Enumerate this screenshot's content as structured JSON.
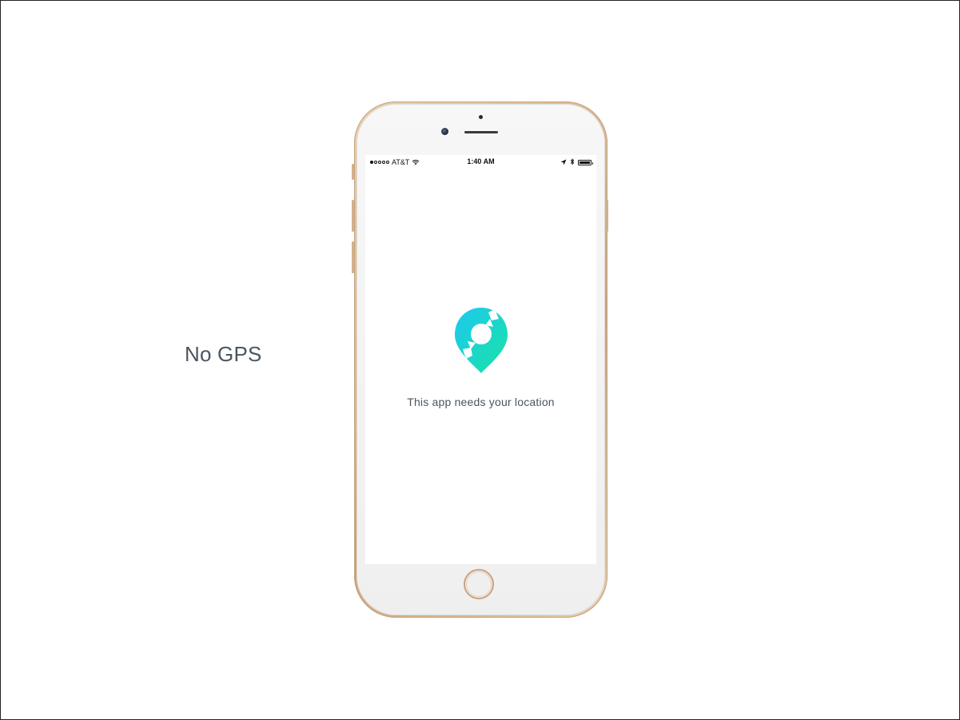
{
  "slide": {
    "label": "No GPS"
  },
  "status_bar": {
    "carrier": "AT&T",
    "time": "1:40 AM",
    "signal_bars_filled": 1,
    "signal_bars_total": 5,
    "battery_level": 1.0
  },
  "app": {
    "message": "This app needs your location",
    "logo_icon": "location-pin-sync-icon",
    "logo_colors": {
      "start": "#1ec8f0",
      "end": "#19e3a4"
    }
  },
  "colors": {
    "phone_body": "#d8b58e",
    "text": "#4a5560"
  }
}
